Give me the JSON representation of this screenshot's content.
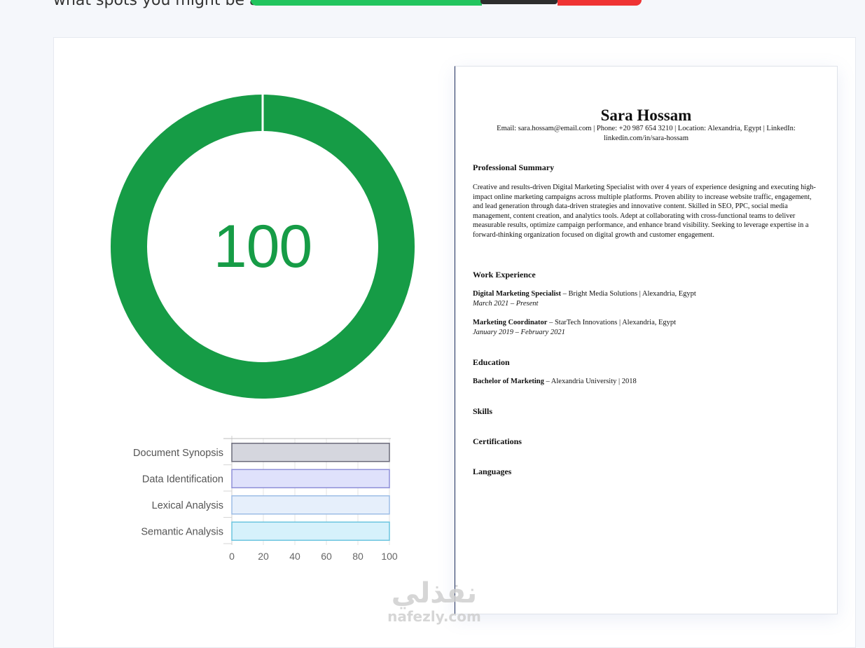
{
  "page": {
    "top_text": "what spots you might be ab",
    "colors": {
      "gauge": "#169c46",
      "background": "#f5f7fb"
    }
  },
  "score": {
    "value": 100,
    "max": 100,
    "label": "100"
  },
  "chart_data": {
    "type": "bar",
    "orientation": "horizontal",
    "categories": [
      "Document Synopsis",
      "Data Identification",
      "Lexical Analysis",
      "Semantic Analysis"
    ],
    "values": [
      100,
      100,
      100,
      100
    ],
    "xlim": [
      0,
      100
    ],
    "xticks": [
      0,
      20,
      40,
      60,
      80,
      100
    ],
    "grid": true,
    "colors": [
      {
        "fill": "#d5d6de",
        "stroke": "#6b6b7a"
      },
      {
        "fill": "#dfe1fb",
        "stroke": "#8f90d8"
      },
      {
        "fill": "#e6effb",
        "stroke": "#9dbde6"
      },
      {
        "fill": "#d6f1fb",
        "stroke": "#6cc5df"
      }
    ]
  },
  "resume": {
    "name": "Sara Hossam",
    "contact_line1": "Email: sara.hossam@email.com | Phone: +20 987 654 3210 | Location: Alexandria, Egypt | LinkedIn:",
    "contact_line2": "linkedin.com/in/sara-hossam",
    "sections": {
      "summary": "Professional Summary",
      "experience": "Work Experience",
      "education": "Education",
      "skills": "Skills",
      "certifications": "Certifications",
      "languages": "Languages"
    },
    "summary_text": "Creative and results-driven Digital Marketing Specialist with over 4 years of experience designing and executing high-impact online marketing campaigns across multiple platforms. Proven ability to increase website traffic, engagement, and lead generation through data-driven strategies and innovative content. Skilled in SEO, PPC, social media management, content creation, and analytics tools. Adept at collaborating with cross-functional teams to deliver measurable results, optimize campaign performance, and enhance brand visibility. Seeking to leverage expertise in a forward-thinking organization focused on digital growth and customer engagement.",
    "jobs": [
      {
        "title": "Digital Marketing Specialist",
        "rest": " – Bright Media Solutions | Alexandria, Egypt",
        "dates": "March 2021 – Present"
      },
      {
        "title": "Marketing Coordinator",
        "rest": " – StarTech Innovations | Alexandria, Egypt",
        "dates": "January 2019 – February 2021"
      }
    ],
    "education": {
      "degree": "Bachelor of Marketing",
      "rest": " – Alexandria University | 2018"
    }
  },
  "watermark": {
    "arabic": "نفذلي",
    "latin": "nafezly.com"
  }
}
